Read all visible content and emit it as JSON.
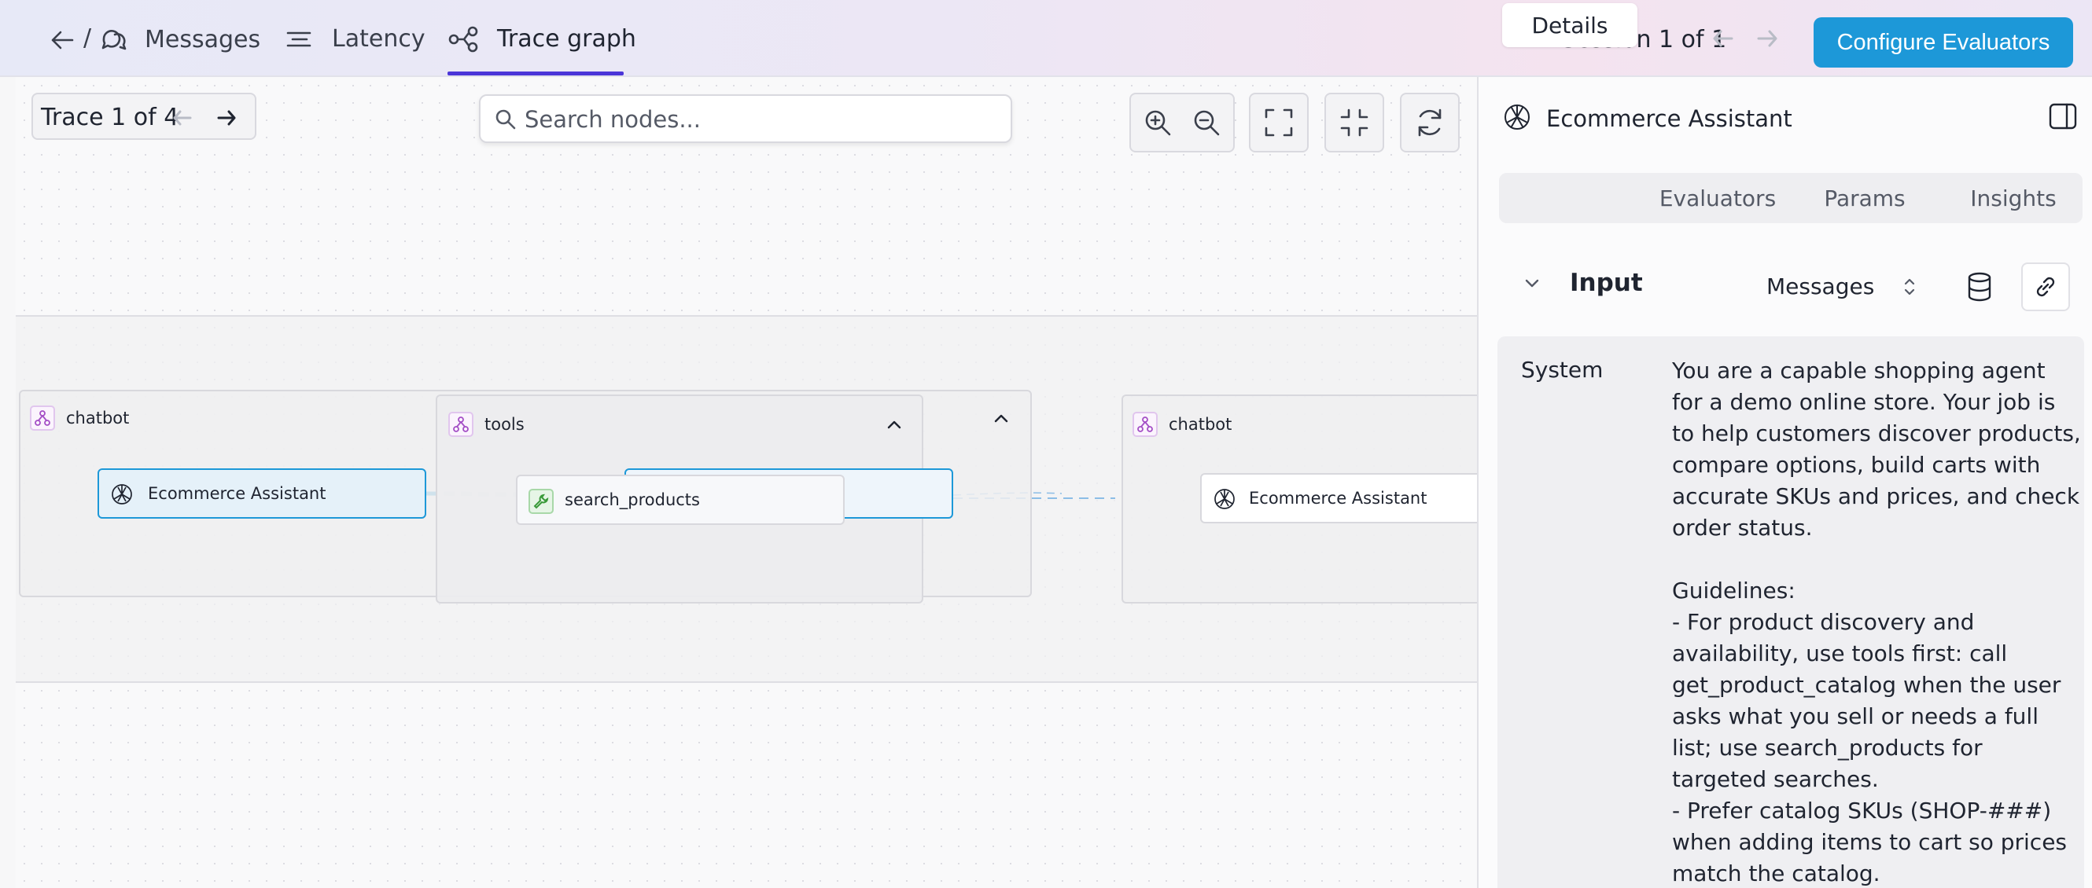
{
  "header": {
    "breadcrumb_sep": "/",
    "tabs": [
      {
        "label": "Messages"
      },
      {
        "label": "Latency"
      },
      {
        "label": "Trace graph",
        "active": true
      }
    ],
    "session_label": "Session 1 of 1",
    "configure_button": "Configure Evaluators",
    "accent_color": "#1d98d8",
    "active_tab_color": "#4b35d8"
  },
  "canvas": {
    "trace_label": "Trace 1 of 4",
    "search_placeholder": "Search nodes...",
    "toolbar_icons": [
      "zoom-in-icon",
      "zoom-out-icon",
      "fit-view-icon",
      "collapse-icon",
      "refresh-icon"
    ],
    "groups": [
      {
        "label": "chatbot",
        "node": "Ecommerce Assistant"
      },
      {
        "label": "tools",
        "node": "search_products"
      },
      {
        "label": "chatbot",
        "node": "Ecommerce Assistant"
      }
    ]
  },
  "panel": {
    "title": "Ecommerce Assistant",
    "tabs": [
      {
        "label": "Details",
        "active": true
      },
      {
        "label": "Evaluators"
      },
      {
        "label": "Params"
      },
      {
        "label": "Insights"
      }
    ],
    "input_section": {
      "label": "Input",
      "format": "Messages",
      "role": "System",
      "content": "You are a capable shopping agent for a demo online store. Your job is to help customers discover products, compare options, build carts with accurate SKUs and prices, and check order status.\n\nGuidelines:\n- For product discovery and availability, use tools first: call get_product_catalog when the user asks what you sell or needs a full list; use search_products for targeted searches.\n- Prefer catalog SKUs (SHOP-###) when adding items to cart so prices match the catalog."
    }
  }
}
